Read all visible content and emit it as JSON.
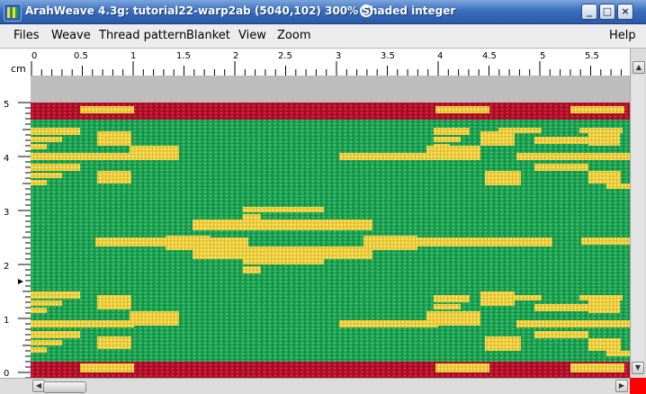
{
  "window": {
    "title": "ArahWeave 4.3g: tutorial22-warp2ab (5040,102) 300% Shaded integer",
    "buttons": [
      "_",
      "□",
      "×"
    ]
  },
  "menu": {
    "left": [
      "Files",
      "Weave",
      "Thread pattern",
      "Blanket",
      "View",
      "Zoom"
    ],
    "right": "Help"
  },
  "ruler": {
    "unit": "cm",
    "x_labels": [
      "0",
      "0.5",
      "1",
      "1.5",
      "2",
      "2.5",
      "3",
      "3.5",
      "4",
      "4.5",
      "5",
      "5.5"
    ],
    "y_labels": [
      "5",
      "4",
      "3",
      "2",
      "1",
      "0"
    ]
  },
  "fabric": {
    "colors": {
      "ground": "#1ea454",
      "red": "#c8102e",
      "yellow": "#f2d43a",
      "gray": "#bdbdbd"
    }
  },
  "icons": {
    "app": "weave-app-icon",
    "title_swirl": "swirl-icon",
    "minimize": "minimize-icon",
    "maximize": "maximize-icon",
    "close": "close-icon",
    "scroll_up": "arrow-up-icon",
    "scroll_down": "arrow-down-icon",
    "scroll_left": "arrow-left-icon",
    "scroll_right": "arrow-right-icon"
  }
}
